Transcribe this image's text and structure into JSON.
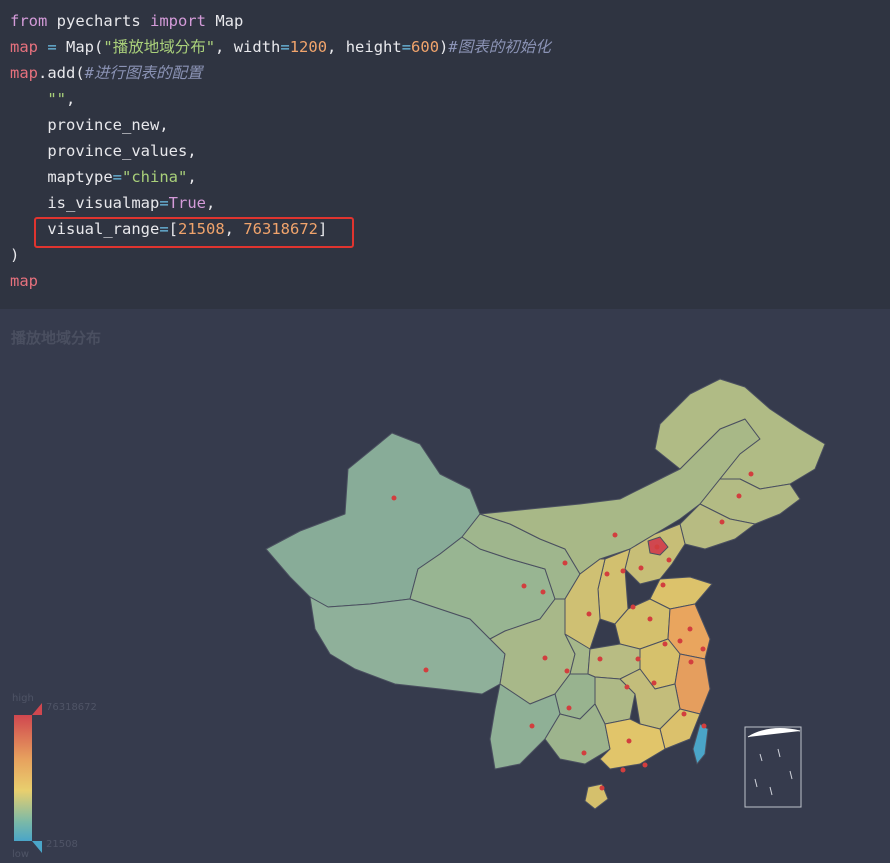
{
  "code": {
    "lines": [
      [
        [
          "kw",
          "from"
        ],
        [
          "plain",
          " pyecharts "
        ],
        [
          "kw",
          "import"
        ],
        [
          "plain",
          " Map"
        ]
      ],
      [
        [
          "var",
          "map"
        ],
        [
          "plain",
          " "
        ],
        [
          "op",
          "="
        ],
        [
          "plain",
          " Map("
        ],
        [
          "str",
          "\"播放地域分布\""
        ],
        [
          "plain",
          ", width"
        ],
        [
          "op",
          "="
        ],
        [
          "num",
          "1200"
        ],
        [
          "plain",
          ", height"
        ],
        [
          "op",
          "="
        ],
        [
          "num",
          "600"
        ],
        [
          "plain",
          ")"
        ],
        [
          "cmt",
          "#图表的初始化"
        ]
      ],
      [
        [
          "var",
          "map"
        ],
        [
          "plain",
          ".add("
        ],
        [
          "cmt",
          "#进行图表的配置"
        ]
      ],
      [
        [
          "plain",
          "    "
        ],
        [
          "str",
          "\"\""
        ],
        [
          "plain",
          ","
        ]
      ],
      [
        [
          "plain",
          "    province_new,"
        ]
      ],
      [
        [
          "plain",
          "    province_values,"
        ]
      ],
      [
        [
          "plain",
          "    maptype"
        ],
        [
          "op",
          "="
        ],
        [
          "str",
          "\"china\""
        ],
        [
          "plain",
          ","
        ]
      ],
      [
        [
          "plain",
          "    is_visualmap"
        ],
        [
          "op",
          "="
        ],
        [
          "kw",
          "True"
        ],
        [
          "plain",
          ","
        ]
      ],
      [
        [
          "plain",
          "    visual_range"
        ],
        [
          "op",
          "="
        ],
        [
          "plain",
          "["
        ],
        [
          "num",
          "21508"
        ],
        [
          "plain",
          ", "
        ],
        [
          "num",
          "76318672"
        ],
        [
          "plain",
          "]"
        ]
      ],
      [
        [
          "plain",
          ")"
        ]
      ],
      [
        [
          "var",
          "map"
        ]
      ]
    ]
  },
  "chart": {
    "title": "播放地域分布",
    "visualmap": {
      "high_label": "high",
      "low_label": "low",
      "max_value": "76318672",
      "min_value": "21508",
      "colors": [
        "#d0474f",
        "#e7a15e",
        "#e8cf6e",
        "#7ab9a8",
        "#4aa5c8"
      ]
    }
  }
}
